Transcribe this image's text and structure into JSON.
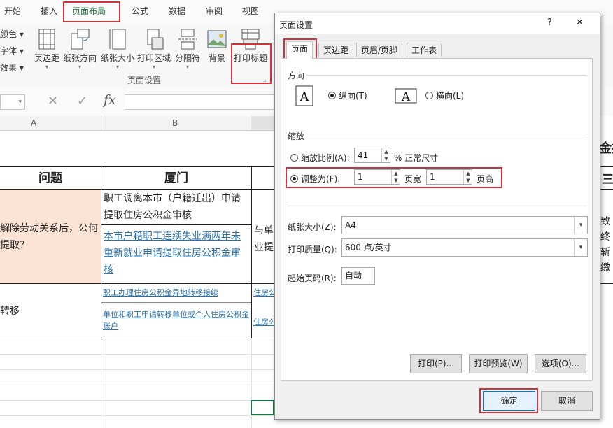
{
  "ribbon_tabs": [
    "开始",
    "插入",
    "页面布局",
    "公式",
    "数据",
    "审阅",
    "视图"
  ],
  "ribbon_left_items": [
    "颜色",
    "字体",
    "效果"
  ],
  "ribbon_buttons": [
    "页边距",
    "纸张方向",
    "纸张大小",
    "打印区域",
    "分隔符",
    "背景",
    "打印标题"
  ],
  "ribbon_group_label": "页面设置",
  "formula_bar": {
    "fx_label": "fx"
  },
  "columns": {
    "a": "A",
    "b": "B"
  },
  "sheet": {
    "headers": [
      "问题",
      "厦门"
    ],
    "right_partial_title": "金提",
    "right_partial_header": "三",
    "row1_question": "解除劳动关系后，公何提取？",
    "row1_cell_top": "职工调离本市（户籍迁出）申请提取住房公积金审核",
    "row1_cell_link": "本市户籍职工连续失业满两年未重新就业申请提取住房公积金审核",
    "row1_partial": "与单业提",
    "row1_right_partial": "致终斩缴",
    "row2_question": "转移",
    "row2_link1": "职工办理住房公积金异地转移接续",
    "row2_link2": "单位和职工申请转移单位或个人住房公积金账户",
    "row2_partial1": "住房公",
    "row2_partial2": "住房公"
  },
  "dialog": {
    "title": "页面设置",
    "help": "?",
    "close": "✕",
    "tabs": [
      "页面",
      "页边距",
      "页眉/页脚",
      "工作表"
    ],
    "orientation": {
      "section": "方向",
      "portrait": "纵向(T)",
      "landscape": "横向(L)",
      "selected": "portrait"
    },
    "scaling": {
      "section": "缩放",
      "adjust_label": "缩放比例(A):",
      "adjust_value": "41",
      "adjust_suffix": "% 正常尺寸",
      "fit_label": "调整为(F):",
      "fit_wide": "1",
      "fit_wide_unit": "页宽",
      "fit_tall": "1",
      "fit_tall_unit": "页高",
      "selected": "fit"
    },
    "paper_size_label": "纸张大小(Z):",
    "paper_size_value": "A4",
    "print_quality_label": "打印质量(Q):",
    "print_quality_value": "600 点/英寸",
    "first_page_label": "起始页码(R):",
    "first_page_value": "自动",
    "buttons": {
      "print": "打印(P)...",
      "preview": "打印预览(W)",
      "options": "选项(O)..."
    },
    "ok": "确定",
    "cancel": "取消"
  },
  "accent_red": "#d0343b",
  "accent_green": "#217346"
}
